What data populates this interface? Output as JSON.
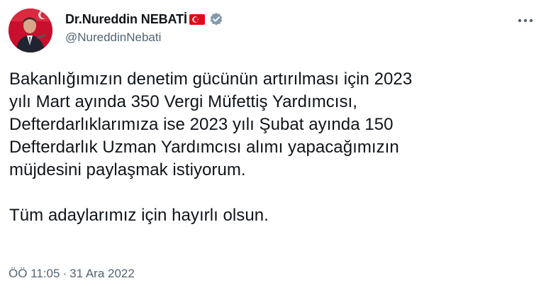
{
  "author": {
    "display_name": "Dr.Nureddin NEBATİ",
    "handle": "@NureddinNebati",
    "avatar_icon": "profile-photo",
    "flag_icon": "turkey-flag-icon",
    "verified_icon": "verified-badge-icon"
  },
  "tweet": {
    "lines": [
      "Bakanlığımızın denetim gücünün artırılması için 2023",
      "yılı Mart ayında 350 Vergi Müfettiş Yardımcısı,",
      "Defterdarlıklarımıza ise 2023 yılı Şubat ayında 150",
      "Defterdarlık Uzman Yardımcısı alımı yapacağımızın",
      "müjdesini paylaşmak istiyorum."
    ],
    "closing_line": "Tüm adaylarımız için hayırlı olsun."
  },
  "meta": {
    "time": "ÖÖ 11:05",
    "separator": "·",
    "date": "31 Ara 2022"
  },
  "colors": {
    "text": "#0f1419",
    "secondary": "#536471",
    "flag_red": "#e30a17",
    "avatar_bg": "#c8102e"
  }
}
